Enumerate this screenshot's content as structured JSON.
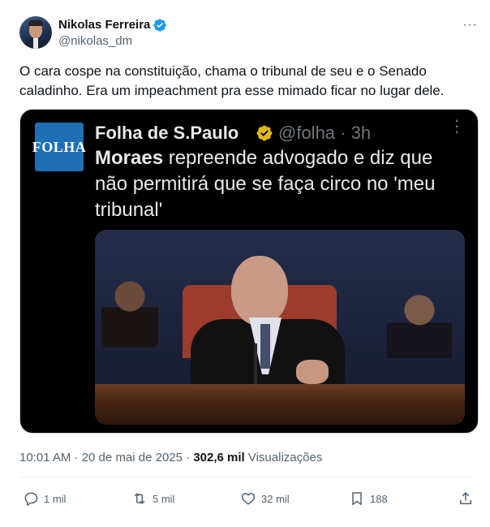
{
  "author": {
    "name": "Nikolas Ferreira",
    "handle": "@nikolas_dm",
    "verified_color": "#1d9bf0",
    "avatar_icon": "profile-photo"
  },
  "more_label": "···",
  "tweet_text": "O cara cospe na constituição, chama o tribunal de seu e o Senado caladinho. Era um impeachment pra esse mimado ficar no lugar dele.",
  "quoted": {
    "logo_text": "FOLHA",
    "name": "Folha de S.Paulo",
    "handle_time": "@folha · 3h",
    "text_bold": "Moraes",
    "text_rest": " repreende advogado e diz que não permitirá que se faça circo no 'meu tribunal'",
    "badge_color": "#e2b719"
  },
  "meta": {
    "time_date": "10:01 AM · 20 de mai de 2025 · ",
    "views_count": "302,6 mil",
    "views_label": " Visualizações"
  },
  "actions": {
    "reply": "1 mil",
    "retweet": "5 mil",
    "like": "32 mil",
    "bookmark": "188"
  },
  "colors": {
    "text": "#0f1419",
    "secondary": "#536471",
    "media_bg": "#000000"
  }
}
